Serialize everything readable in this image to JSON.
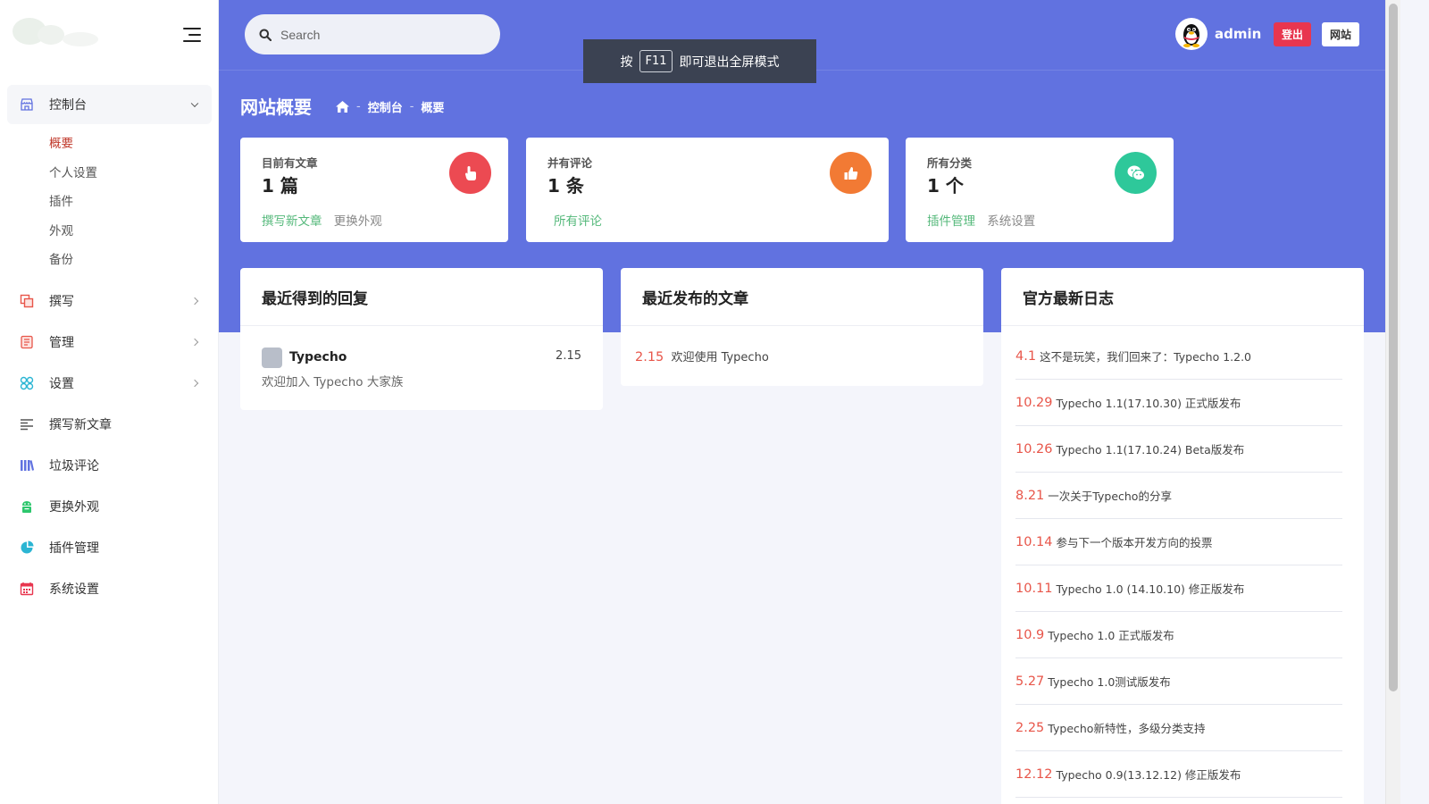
{
  "header": {
    "search_placeholder": "Search",
    "toast_prefix": "按",
    "toast_key": "F11",
    "toast_suffix": "即可退出全屏模式",
    "username": "admin",
    "logout_label": "登出",
    "site_label": "网站"
  },
  "sidebar": {
    "items": [
      {
        "label": "控制台",
        "icon": "store-icon",
        "color": "#6172e0"
      },
      {
        "label": "撰写",
        "icon": "copy-icon",
        "color": "#e8564a"
      },
      {
        "label": "管理",
        "icon": "list-box-icon",
        "color": "#e8564a"
      },
      {
        "label": "设置",
        "icon": "apps-icon",
        "color": "#2bb5d3"
      },
      {
        "label": "撰写新文章",
        "icon": "align-left-icon",
        "color": "#555"
      },
      {
        "label": "垃圾评论",
        "icon": "library-icon",
        "color": "#6172e0"
      },
      {
        "label": "更换外观",
        "icon": "android-icon",
        "color": "#2dc76d"
      },
      {
        "label": "插件管理",
        "icon": "pie-chart-icon",
        "color": "#2bb5d3"
      },
      {
        "label": "系统设置",
        "icon": "calendar-icon",
        "color": "#e8364f"
      }
    ],
    "subitems": [
      "概要",
      "个人设置",
      "插件",
      "外观",
      "备份"
    ]
  },
  "page": {
    "title": "网站概要",
    "breadcrumb": [
      "控制台",
      "概要"
    ]
  },
  "stats": [
    {
      "label": "目前有文章",
      "value": "1 篇",
      "links": [
        "撰写新文章",
        "更换外观"
      ],
      "icon": "hand-pointer-icon",
      "color": "#ec4a52"
    },
    {
      "label": "并有评论",
      "value": "1 条",
      "links": [
        "所有评论"
      ],
      "icon": "thumbs-up-icon",
      "color": "#f27a34"
    },
    {
      "label": "所有分类",
      "value": "1 个",
      "links": [
        "插件管理",
        "系统设置"
      ],
      "icon": "wechat-icon",
      "color": "#2ec89a"
    }
  ],
  "colors": {
    "header_bg": "#6172e0",
    "link_green": "#54b87a",
    "link_gray": "#888888",
    "date_red": "#e8564a"
  },
  "panels": {
    "replies": {
      "title": "最近得到的回复",
      "items": [
        {
          "author": "Typecho",
          "date": "2.15",
          "text": "欢迎加入 Typecho 大家族"
        }
      ]
    },
    "posts": {
      "title": "最近发布的文章",
      "items": [
        {
          "date": "2.15",
          "title": "欢迎使用 Typecho"
        }
      ]
    },
    "logs": {
      "title": "官方最新日志",
      "items": [
        {
          "date": "4.1",
          "title": "这不是玩笑，我们回来了：Typecho 1.2.0"
        },
        {
          "date": "10.29",
          "title": "Typecho 1.1(17.10.30) 正式版发布"
        },
        {
          "date": "10.26",
          "title": "Typecho 1.1(17.10.24) Beta版发布"
        },
        {
          "date": "8.21",
          "title": "一次关于Typecho的分享"
        },
        {
          "date": "10.14",
          "title": "参与下一个版本开发方向的投票"
        },
        {
          "date": "10.11",
          "title": "Typecho 1.0 (14.10.10) 修正版发布"
        },
        {
          "date": "10.9",
          "title": "Typecho 1.0 正式版发布"
        },
        {
          "date": "5.27",
          "title": "Typecho 1.0测试版发布"
        },
        {
          "date": "2.25",
          "title": "Typecho新特性，多级分类支持"
        },
        {
          "date": "12.12",
          "title": "Typecho 0.9(13.12.12) 修正版发布"
        }
      ]
    }
  }
}
